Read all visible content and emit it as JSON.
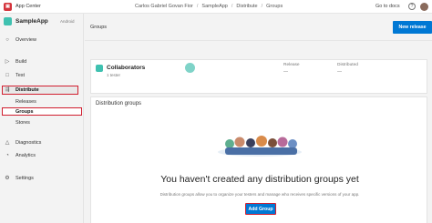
{
  "topbar": {
    "logo_letter": "▣",
    "app_center": "App Center",
    "breadcrumbs": [
      "Carlos Gabriel Govan Fior",
      "SampleApp",
      "Distribute",
      "Groups"
    ],
    "go_to_docs": "Go to docs",
    "help_icon": "?"
  },
  "sidebar": {
    "app_name": "SampleApp",
    "app_os": "Android",
    "items": {
      "overview": "Overview",
      "build": "Build",
      "test": "Test",
      "distribute": "Distribute",
      "releases": "Releases",
      "groups": "Groups",
      "stores": "Stores",
      "diagnostics": "Diagnostics",
      "analytics": "Analytics",
      "settings": "Settings"
    },
    "highlight_color": "#d11e2f"
  },
  "main": {
    "title": "Groups",
    "new_release_label": "New release",
    "collaborators": {
      "name": "Collaborators",
      "sub": "1 tester",
      "release_label": "Release",
      "release_value": "—",
      "distributed_label": "Distributed",
      "distributed_value": "—"
    },
    "distribution_groups": {
      "title": "Distribution groups",
      "empty_title": "You haven't created any distribution groups yet",
      "empty_desc": "Distribution groups allow you to organize your testers and manage who receives specific versions of your app.",
      "add_group_label": "Add Group"
    }
  },
  "colors": {
    "accent": "#0078d4",
    "app_icon": "#3fc1b0"
  }
}
